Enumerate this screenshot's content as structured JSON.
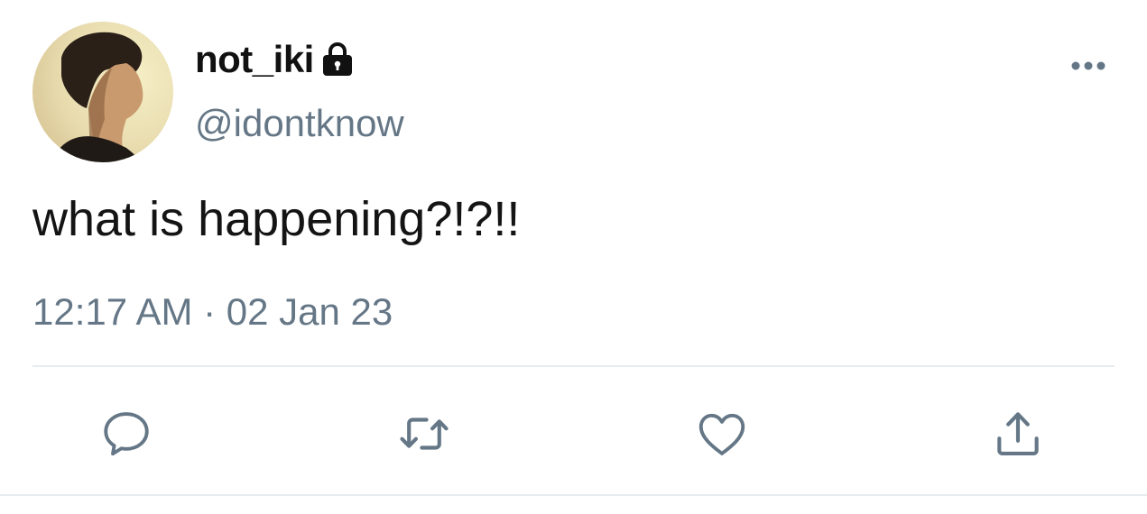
{
  "tweet": {
    "avatar_icon": "profile-photo",
    "display_name": "not_iki",
    "protected_icon": "lock-icon",
    "handle": "@idontknow",
    "more_icon": "more-horizontal-icon",
    "text": "what is happening?!?!!",
    "timestamp": "12:17 AM · 02 Jan 23"
  },
  "actions": [
    {
      "name": "reply",
      "icon": "reply-icon"
    },
    {
      "name": "retweet",
      "icon": "retweet-icon"
    },
    {
      "name": "like",
      "icon": "heart-icon"
    },
    {
      "name": "share",
      "icon": "share-icon"
    }
  ],
  "colors": {
    "text_primary": "#141414",
    "text_secondary": "#657786",
    "icon": "#657786",
    "divider": "#e6ecf0",
    "background": "#ffffff"
  }
}
